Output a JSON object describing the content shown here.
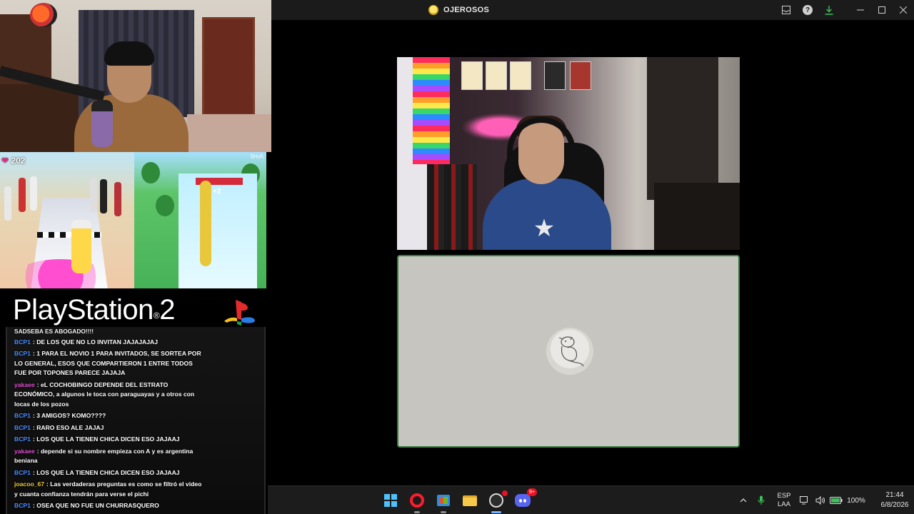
{
  "window": {
    "title": "OJEROSOS",
    "icons": [
      "inbox-icon",
      "help-icon",
      "download-icon",
      "minimize-icon",
      "maximize-icon",
      "close-icon"
    ]
  },
  "overlay": {
    "hearts": "202",
    "game_gate_label": "+2",
    "game_corner_label": "9mA",
    "console_brand": "PlayStation",
    "console_brand_number": "2"
  },
  "chat": {
    "header": "SADSEBA ES ABOGADO!!!!",
    "messages": [
      {
        "user": "BCP1",
        "user_color": "#4a8cff",
        "text": "DE LOS QUE NO LO INVITAN JAJAJAJAJ"
      },
      {
        "user": "BCP1",
        "user_color": "#4a8cff",
        "text": "1 PARA EL NOVIO 1 PARA INVITADOS, SE SORTEA POR LO GENERAL, ESOS QUE COMPARTIERON 1 ENTRE TODOS FUE POR TOPONES PARECE JAJAJA"
      },
      {
        "user": "yakaee",
        "user_color": "#e24bd5",
        "text": "eL COCHOBINGO DEPENDE DEL ESTRATO ECONÓMICO, a algunos le toca con paraguayas y a otros con locas de los pozos"
      },
      {
        "user": "BCP1",
        "user_color": "#4a8cff",
        "text": "3 AMIGOS? KOMO????"
      },
      {
        "user": "BCP1",
        "user_color": "#4a8cff",
        "text": "RARO ESO ALE JAJAJ"
      },
      {
        "user": "BCP1",
        "user_color": "#4a8cff",
        "text": "LOS QUE LA TIENEN CHICA DICEN ESO JAJAAJ"
      },
      {
        "user": "yakaee",
        "user_color": "#e24bd5",
        "text": "depende si su nombre empieza con A y es argentina beniana"
      },
      {
        "user": "BCP1",
        "user_color": "#4a8cff",
        "text": "LOS QUE LA TIENEN CHICA DICEN ESO JAJAAJ"
      },
      {
        "user": "joacoo_67",
        "user_color": "#e8c83a",
        "text": "Las verdaderas preguntas es como se filtró el video y cuanta confianza tendrán para verse el pichi"
      },
      {
        "user": "BCP1",
        "user_color": "#4a8cff",
        "text": "OSEA QUE NO FUE UN CHURRASQUERO"
      }
    ]
  },
  "taskbar": {
    "apps": [
      {
        "name": "windows-start",
        "active": false
      },
      {
        "name": "opera-browser",
        "active": false
      },
      {
        "name": "microsoft-store",
        "active": false
      },
      {
        "name": "file-explorer",
        "active": false
      },
      {
        "name": "obs-studio",
        "active": true
      },
      {
        "name": "discord",
        "active": false,
        "badge": "9+"
      }
    ],
    "tray": {
      "language_line1": "ESP",
      "language_line2": "LAA",
      "battery": "100%",
      "time": "21:44",
      "date": "6/8/2026"
    }
  },
  "colors": {
    "accent_green": "#3a7a42",
    "download_green": "#3fbf5a",
    "taskbar_active": "#74b4ff"
  }
}
